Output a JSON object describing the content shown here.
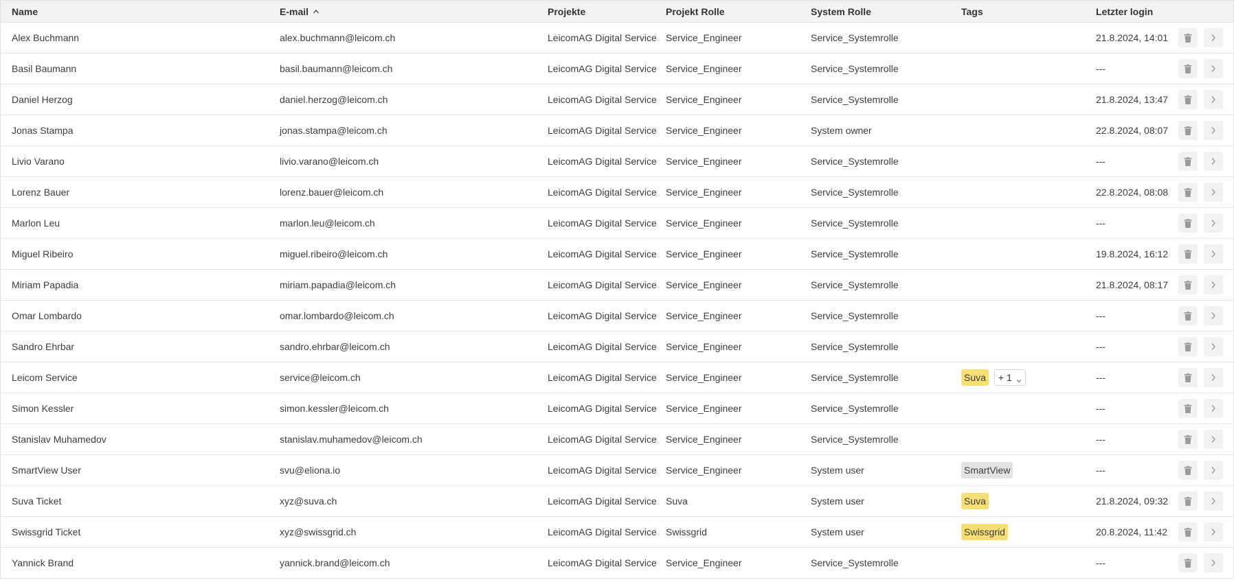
{
  "columns": {
    "name": "Name",
    "email": "E-mail",
    "projects": "Projekte",
    "project_role": "Projekt Rolle",
    "system_role": "System Rolle",
    "tags": "Tags",
    "last_login": "Letzter login"
  },
  "sort": {
    "column": "email",
    "direction": "ascending",
    "icon": "sort-ascending-icon"
  },
  "colors": {
    "header_bg": "#f3f3f3",
    "tag_yellow": "#f7df73",
    "tag_grey": "#e3e3e3",
    "button_bg": "#f2f2f2",
    "icon_grey": "#9a9a9a",
    "border": "#e4e4e4"
  },
  "actions": {
    "delete_icon": "trash-icon",
    "open_icon": "chevron-right-icon"
  },
  "rows": [
    {
      "name": "Alex Buchmann",
      "email": "alex.buchmann@leicom.ch",
      "project": "LeicomAG Digital Service",
      "project_role": "Service_Engineer",
      "system_role": "Service_Systemrolle",
      "tags": [],
      "last_login": "21.8.2024, 14:01"
    },
    {
      "name": "Basil Baumann",
      "email": "basil.baumann@leicom.ch",
      "project": "LeicomAG Digital Service",
      "project_role": "Service_Engineer",
      "system_role": "Service_Systemrolle",
      "tags": [],
      "last_login": "---"
    },
    {
      "name": "Daniel Herzog",
      "email": "daniel.herzog@leicom.ch",
      "project": "LeicomAG Digital Service",
      "project_role": "Service_Engineer",
      "system_role": "Service_Systemrolle",
      "tags": [],
      "last_login": "21.8.2024, 13:47"
    },
    {
      "name": "Jonas Stampa",
      "email": "jonas.stampa@leicom.ch",
      "project": "LeicomAG Digital Service",
      "project_role": "Service_Engineer",
      "system_role": "System owner",
      "tags": [],
      "last_login": "22.8.2024, 08:07"
    },
    {
      "name": "Livio Varano",
      "email": "livio.varano@leicom.ch",
      "project": "LeicomAG Digital Service",
      "project_role": "Service_Engineer",
      "system_role": "Service_Systemrolle",
      "tags": [],
      "last_login": "---"
    },
    {
      "name": "Lorenz Bauer",
      "email": "lorenz.bauer@leicom.ch",
      "project": "LeicomAG Digital Service",
      "project_role": "Service_Engineer",
      "system_role": "Service_Systemrolle",
      "tags": [],
      "last_login": "22.8.2024, 08:08"
    },
    {
      "name": "Marlon Leu",
      "email": "marlon.leu@leicom.ch",
      "project": "LeicomAG Digital Service",
      "project_role": "Service_Engineer",
      "system_role": "Service_Systemrolle",
      "tags": [],
      "last_login": "---"
    },
    {
      "name": "Miguel Ribeiro",
      "email": "miguel.ribeiro@leicom.ch",
      "project": "LeicomAG Digital Service",
      "project_role": "Service_Engineer",
      "system_role": "Service_Systemrolle",
      "tags": [],
      "last_login": "19.8.2024, 16:12"
    },
    {
      "name": "Miriam Papadia",
      "email": "miriam.papadia@leicom.ch",
      "project": "LeicomAG Digital Service",
      "project_role": "Service_Engineer",
      "system_role": "Service_Systemrolle",
      "tags": [],
      "last_login": "21.8.2024, 08:17"
    },
    {
      "name": "Omar Lombardo",
      "email": "omar.lombardo@leicom.ch",
      "project": "LeicomAG Digital Service",
      "project_role": "Service_Engineer",
      "system_role": "Service_Systemrolle",
      "tags": [],
      "last_login": "---"
    },
    {
      "name": "Sandro Ehrbar",
      "email": "sandro.ehrbar@leicom.ch",
      "project": "LeicomAG Digital Service",
      "project_role": "Service_Engineer",
      "system_role": "Service_Systemrolle",
      "tags": [],
      "last_login": "---"
    },
    {
      "name": "Leicom Service",
      "email": "service@leicom.ch",
      "project": "LeicomAG Digital Service",
      "project_role": "Service_Engineer",
      "system_role": "Service_Systemrolle",
      "tags": [
        {
          "label": "Suva",
          "color": "#f7df73"
        }
      ],
      "more": "+ 1",
      "last_login": "---"
    },
    {
      "name": "Simon Kessler",
      "email": "simon.kessler@leicom.ch",
      "project": "LeicomAG Digital Service",
      "project_role": "Service_Engineer",
      "system_role": "Service_Systemrolle",
      "tags": [],
      "last_login": "---"
    },
    {
      "name": "Stanislav Muhamedov",
      "email": "stanislav.muhamedov@leicom.ch",
      "project": "LeicomAG Digital Service",
      "project_role": "Service_Engineer",
      "system_role": "Service_Systemrolle",
      "tags": [],
      "last_login": "---"
    },
    {
      "name": "SmartView User",
      "email": "svu@eliona.io",
      "project": "LeicomAG Digital Service",
      "project_role": "Service_Engineer",
      "system_role": "System user",
      "tags": [
        {
          "label": "SmartView",
          "color": "#e3e3e3"
        }
      ],
      "last_login": "---"
    },
    {
      "name": "Suva Ticket",
      "email": "xyz@suva.ch",
      "project": "LeicomAG Digital Service",
      "project_role": "Suva",
      "system_role": "System user",
      "tags": [
        {
          "label": "Suva",
          "color": "#f7df73"
        }
      ],
      "last_login": "21.8.2024, 09:32"
    },
    {
      "name": "Swissgrid Ticket",
      "email": "xyz@swissgrid.ch",
      "project": "LeicomAG Digital Service",
      "project_role": "Swissgrid",
      "system_role": "System user",
      "tags": [
        {
          "label": "Swissgrid",
          "color": "#f7df73"
        }
      ],
      "last_login": "20.8.2024, 11:42"
    },
    {
      "name": "Yannick Brand",
      "email": "yannick.brand@leicom.ch",
      "project": "LeicomAG Digital Service",
      "project_role": "Service_Engineer",
      "system_role": "Service_Systemrolle",
      "tags": [],
      "last_login": "---"
    }
  ]
}
